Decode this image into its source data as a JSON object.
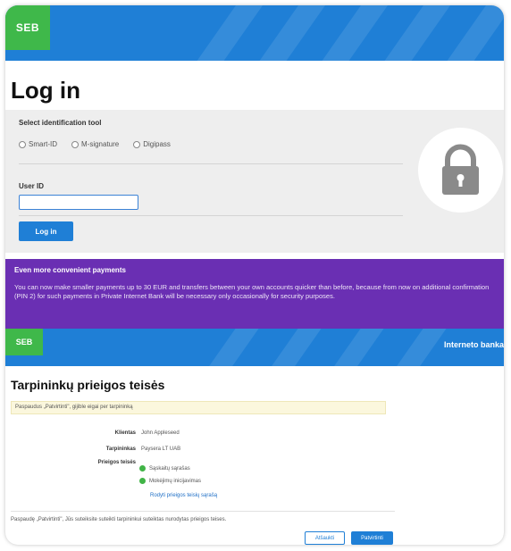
{
  "brand": {
    "logo_text": "SEB",
    "primary_color": "#1f7fd6",
    "green_color": "#3fb84a",
    "promo_color": "#6a2fb3"
  },
  "login": {
    "title": "Log in",
    "select_label": "Select identification tool",
    "options": [
      "Smart-ID",
      "M-signature",
      "Digipass"
    ],
    "user_id_label": "User ID",
    "user_id_value": "",
    "button_label": "Log in",
    "lock_icon": "lock-icon"
  },
  "promo": {
    "title": "Even more convenient payments",
    "text": "You can now make smaller payments up to 30 EUR and transfers between your own accounts quicker than before, because from now on additional confirmation (PIN 2) for such payments in Private Internet Bank will be necessary only occasionally for security purposes."
  },
  "bank_header": {
    "right_text": "Interneto banka"
  },
  "access": {
    "title": "Tarpininkų prieigos teisės",
    "hint": "Paspaudus „Patvirtinti\", gijible eigai per tarpininką",
    "client_label": "Klientas",
    "client_value": "John Appleseed",
    "intermediary_label": "Tarpininkas",
    "intermediary_value": "Paysera LT UAB",
    "rights_label": "Prieigos teisės",
    "rights": [
      "Sąskaitų sąrašas",
      "Mokėjimų inicijavimas"
    ],
    "show_rights_link": "Rodyti prieigos teisių sąrašą",
    "footer_note": "Paspaudę „Patvirtinti\", Jūs suteiksite suteikti tarpininkui suteiktas nurodytas prieigos teises.",
    "cancel_label": "Atšaukti",
    "confirm_label": "Patvirtinti"
  }
}
